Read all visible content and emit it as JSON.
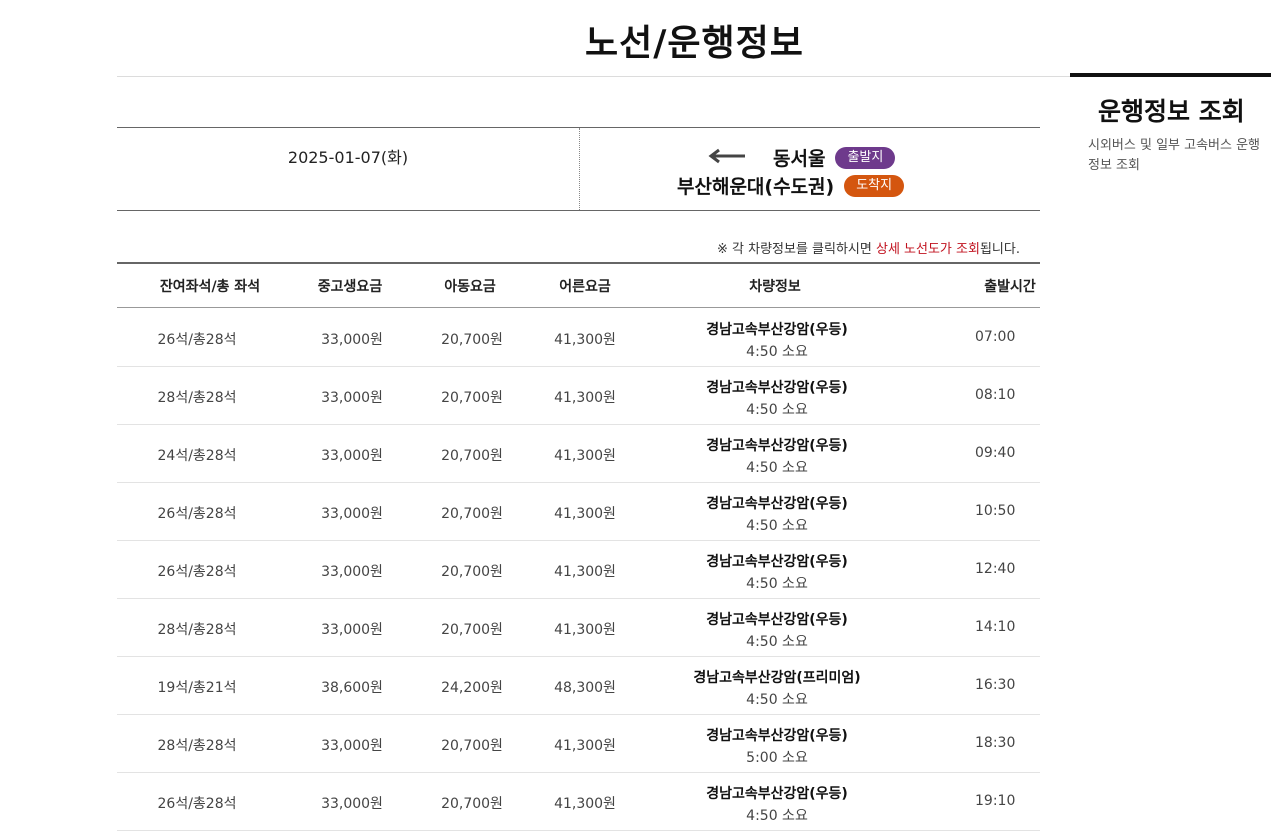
{
  "page": {
    "title": "노선/운행정보"
  },
  "side": {
    "title": "운행정보 조회",
    "description": "시외버스 및 일부 고속버스 운행정보 조회"
  },
  "route": {
    "date": "2025-01-07(화)",
    "departure_badge": "출발지",
    "departure": "동서울",
    "arrival_badge": "도착지",
    "arrival": "부산해운대(수도권)",
    "arrow_icon": "arrow-left-icon"
  },
  "notice": {
    "prefix": "※ 각 차량정보를 클릭하시면 ",
    "highlight": "상세 노선도가 조회",
    "suffix": "됩니다."
  },
  "table": {
    "headers": {
      "time": "출발시간",
      "bus": "차량정보",
      "adult": "어른요금",
      "child": "아동요금",
      "senior": "중고생요금",
      "seats": "잔여좌석/총 좌석"
    },
    "rows": [
      {
        "time": "07:00",
        "bus": "경남고속부산강암(우등)",
        "duration": "4:50 소요",
        "adult": "41,300원",
        "child": "20,700원",
        "senior": "33,000원",
        "seats": "26석/총28석"
      },
      {
        "time": "08:10",
        "bus": "경남고속부산강암(우등)",
        "duration": "4:50 소요",
        "adult": "41,300원",
        "child": "20,700원",
        "senior": "33,000원",
        "seats": "28석/총28석"
      },
      {
        "time": "09:40",
        "bus": "경남고속부산강암(우등)",
        "duration": "4:50 소요",
        "adult": "41,300원",
        "child": "20,700원",
        "senior": "33,000원",
        "seats": "24석/총28석"
      },
      {
        "time": "10:50",
        "bus": "경남고속부산강암(우등)",
        "duration": "4:50 소요",
        "adult": "41,300원",
        "child": "20,700원",
        "senior": "33,000원",
        "seats": "26석/총28석"
      },
      {
        "time": "12:40",
        "bus": "경남고속부산강암(우등)",
        "duration": "4:50 소요",
        "adult": "41,300원",
        "child": "20,700원",
        "senior": "33,000원",
        "seats": "26석/총28석"
      },
      {
        "time": "14:10",
        "bus": "경남고속부산강암(우등)",
        "duration": "4:50 소요",
        "adult": "41,300원",
        "child": "20,700원",
        "senior": "33,000원",
        "seats": "28석/총28석"
      },
      {
        "time": "16:30",
        "bus": "경남고속부산강암(프리미엄)",
        "duration": "4:50 소요",
        "adult": "48,300원",
        "child": "24,200원",
        "senior": "38,600원",
        "seats": "19석/총21석"
      },
      {
        "time": "18:30",
        "bus": "경남고속부산강암(우등)",
        "duration": "5:00 소요",
        "adult": "41,300원",
        "child": "20,700원",
        "senior": "33,000원",
        "seats": "28석/총28석"
      },
      {
        "time": "19:10",
        "bus": "경남고속부산강암(우등)",
        "duration": "4:50 소요",
        "adult": "41,300원",
        "child": "20,700원",
        "senior": "33,000원",
        "seats": "26석/총28석"
      }
    ]
  }
}
